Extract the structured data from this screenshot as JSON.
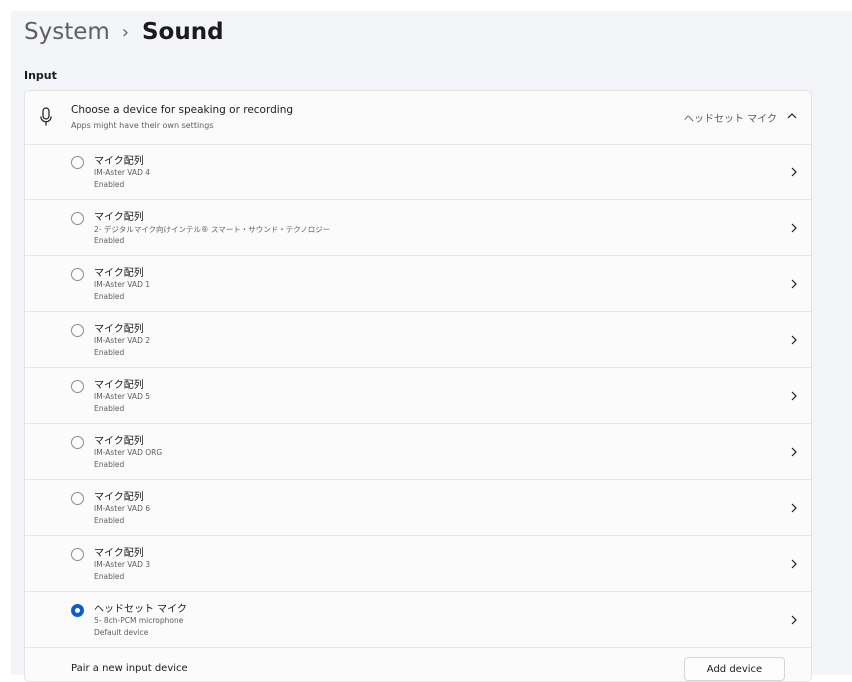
{
  "breadcrumb": {
    "parent": "System",
    "separator": "›",
    "current": "Sound"
  },
  "section": {
    "label": "Input"
  },
  "input_device": {
    "title": "Choose a device for speaking or recording",
    "subtitle": "Apps might have their own settings",
    "selected_value": "ヘッドセット マイク",
    "icon": "microphone-icon",
    "expanded": true
  },
  "devices": [
    {
      "name": "マイク配列",
      "description": "IM-Aster VAD 4",
      "status": "Enabled",
      "selected": false
    },
    {
      "name": "マイク配列",
      "description": "2- デジタルマイク向けインテル® スマート・サウンド・テクノロジー",
      "status": "Enabled",
      "selected": false
    },
    {
      "name": "マイク配列",
      "description": "IM-Aster VAD 1",
      "status": "Enabled",
      "selected": false
    },
    {
      "name": "マイク配列",
      "description": "IM-Aster VAD 2",
      "status": "Enabled",
      "selected": false
    },
    {
      "name": "マイク配列",
      "description": "IM-Aster VAD 5",
      "status": "Enabled",
      "selected": false
    },
    {
      "name": "マイク配列",
      "description": "IM-Aster VAD ORG",
      "status": "Enabled",
      "selected": false
    },
    {
      "name": "マイク配列",
      "description": "IM-Aster VAD 6",
      "status": "Enabled",
      "selected": false
    },
    {
      "name": "マイク配列",
      "description": "IM-Aster VAD 3",
      "status": "Enabled",
      "selected": false
    },
    {
      "name": "ヘッドセット マイク",
      "description": "5- 8ch-PCM microphone",
      "status": "Default device",
      "selected": true
    }
  ],
  "pair": {
    "label": "Pair a new input device",
    "button_label": "Add device"
  },
  "colors": {
    "accent": "#0a5fc7",
    "page_bg": "#f3f5f9",
    "card_bg": "#fbfbfb"
  }
}
